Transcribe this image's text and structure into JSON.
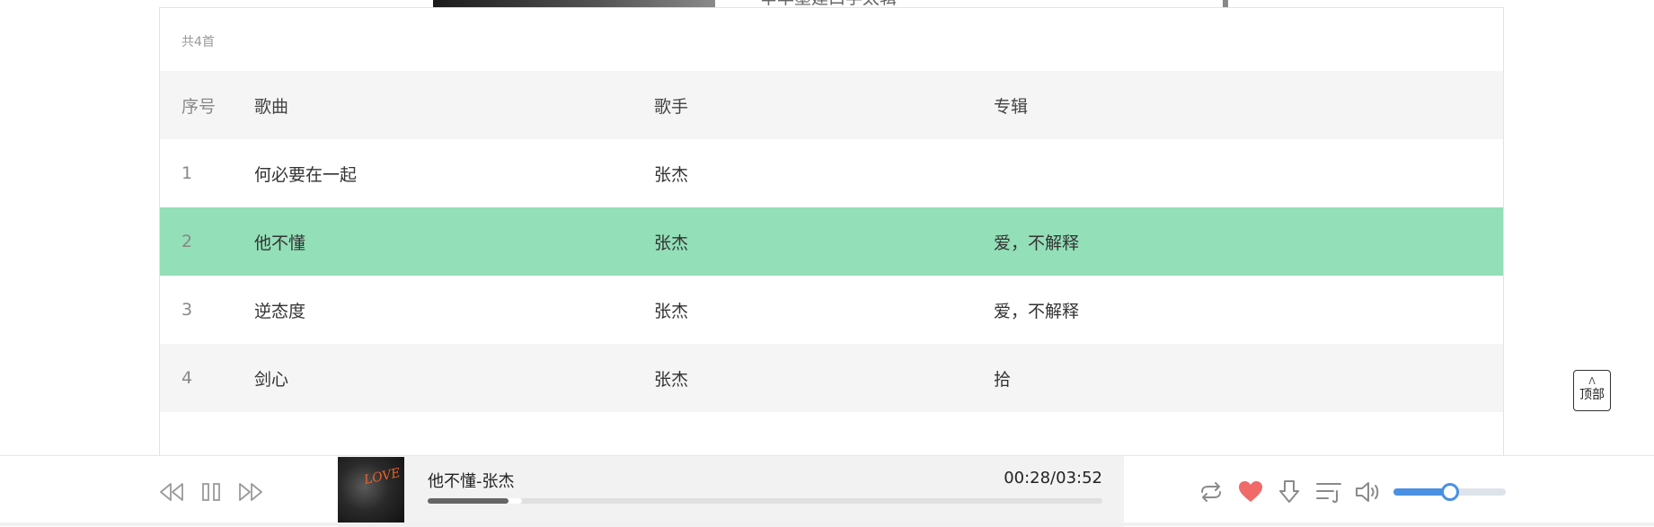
{
  "background": {
    "text": "辛丰墨建口学太辑"
  },
  "list": {
    "count_label": "共4首",
    "headers": {
      "index": "序号",
      "song": "歌曲",
      "singer": "歌手",
      "album": "专辑"
    },
    "rows": [
      {
        "index": "1",
        "song": "何必要在一起",
        "singer": "张杰",
        "album": ""
      },
      {
        "index": "2",
        "song": "他不懂",
        "singer": "张杰",
        "album": "爱，不解释",
        "playing": true
      },
      {
        "index": "3",
        "song": "逆态度",
        "singer": "张杰",
        "album": "爱，不解释"
      },
      {
        "index": "4",
        "song": "剑心",
        "singer": "张杰",
        "album": "拾"
      }
    ],
    "active_color": "#93dfb8"
  },
  "to_top": {
    "arrow": "ᐱ",
    "label": "顶部"
  },
  "player": {
    "cover_text": "LOVE",
    "title": "他不懂-张杰",
    "time": "00:28/03:52",
    "progress": 0.12,
    "buffered": 0.14,
    "volume": 0.5,
    "icons": [
      "previous-icon",
      "pause-icon",
      "next-icon",
      "loop-icon",
      "heart-icon",
      "download-icon",
      "playlist-icon",
      "volume-icon"
    ],
    "heart_color": "#f06a6a",
    "accent_color": "#4a90e2"
  }
}
